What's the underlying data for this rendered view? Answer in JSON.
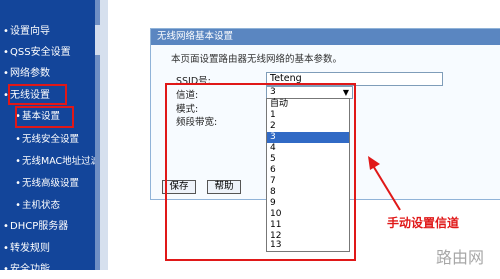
{
  "sidebar": {
    "items": [
      {
        "label": "设置向导"
      },
      {
        "label": "QSS安全设置"
      },
      {
        "label": "网络参数"
      },
      {
        "label": "无线设置"
      },
      {
        "label": "基本设置"
      },
      {
        "label": "无线安全设置"
      },
      {
        "label": "无线MAC地址过滤"
      },
      {
        "label": "无线高级设置"
      },
      {
        "label": "主机状态"
      },
      {
        "label": "DHCP服务器"
      },
      {
        "label": "转发规则"
      },
      {
        "label": "安全功能"
      }
    ]
  },
  "panel": {
    "title": "无线网络基本设置",
    "description": "本页面设置路由器无线网络的基本参数。",
    "ssid_label": "SSID号:",
    "ssid_value": "Teteng",
    "channel_label": "信道:",
    "channel_value": "3",
    "mode_label": "模式:",
    "bandwidth_label": "频段带宽:",
    "channel_options": [
      "自动",
      "1",
      "2",
      "3",
      "4",
      "5",
      "6",
      "7",
      "8",
      "9",
      "10",
      "11",
      "12",
      "13"
    ],
    "selected_option": "3",
    "save_label": "保存",
    "help_label": "帮助"
  },
  "annotation": {
    "text": "手动设置信道",
    "color": "#e01818"
  },
  "watermark": "路由网",
  "colors": {
    "sidebar_bg": "#13459a",
    "panel_title_bg": "#5a86c1",
    "selection": "#316ac5"
  }
}
